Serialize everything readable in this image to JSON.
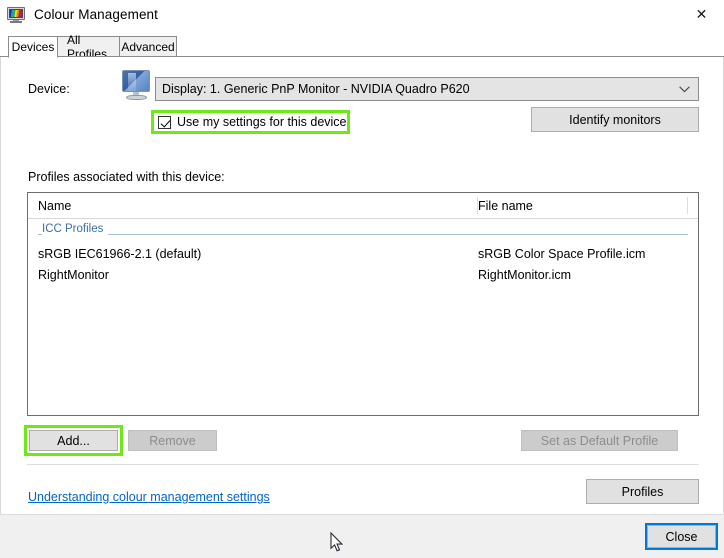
{
  "window": {
    "title": "Colour Management",
    "icon": "colour-management-monitor-icon",
    "close_glyph": "✕"
  },
  "tabs": [
    {
      "label": "Devices",
      "selected": true
    },
    {
      "label": "All Profiles",
      "selected": false
    },
    {
      "label": "Advanced",
      "selected": false
    }
  ],
  "device_section": {
    "label": "Device:",
    "icon": "monitor-icon",
    "selected_device": "Display: 1. Generic PnP Monitor - NVIDIA Quadro P620",
    "dropdown_arrow": "⌄",
    "checkbox_label": "Use my settings for this device",
    "checkbox_checked": true,
    "identify_button": "Identify monitors"
  },
  "profiles_section": {
    "heading": "Profiles associated with this device:",
    "columns": [
      "Name",
      "File name"
    ],
    "group_label": "ICC Profiles",
    "rows": [
      {
        "name": "sRGB IEC61966-2.1 (default)",
        "file": "sRGB Color Space Profile.icm"
      },
      {
        "name": "RightMonitor",
        "file": "RightMonitor.icm"
      }
    ]
  },
  "actions": {
    "add": "Add...",
    "remove": "Remove",
    "remove_disabled": true,
    "set_default": "Set as Default Profile",
    "set_default_disabled": true,
    "profiles": "Profiles"
  },
  "link": {
    "text": "Understanding colour management settings"
  },
  "footer": {
    "close": "Close"
  },
  "highlights": {
    "color": "#6ee817",
    "targets": [
      "use-my-settings-checkbox",
      "add-button"
    ]
  },
  "focus": {
    "color": "#0078d7",
    "element": "close-button"
  }
}
